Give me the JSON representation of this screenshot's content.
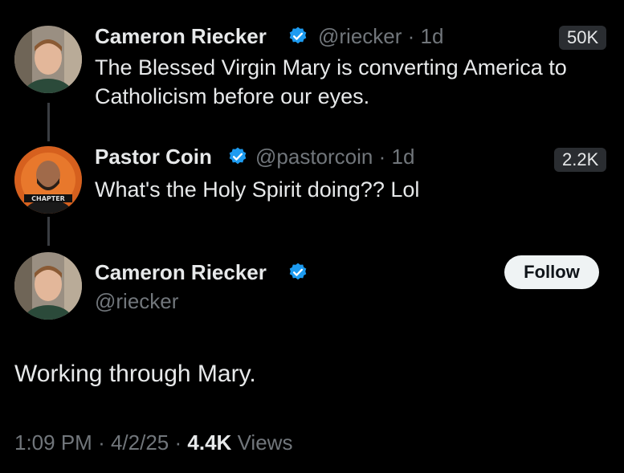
{
  "thread": [
    {
      "name": "Cameron Riecker",
      "handle": "@riecker",
      "dot": "·",
      "age": "1d",
      "text": "The Blessed Virgin Mary is converting America to Catholicism before our eyes.",
      "count": "50K"
    },
    {
      "name": "Pastor Coin",
      "handle": "@pastorcoin",
      "dot": "·",
      "age": "1d",
      "text": "What's the Holy Spirit doing?? Lol",
      "count": "2.2K"
    }
  ],
  "main": {
    "name": "Cameron Riecker",
    "handle": "@riecker",
    "follow_label": "Follow",
    "text": "Working through Mary.",
    "time": "1:09 PM",
    "sep": "·",
    "date": "4/2/25",
    "views_count": "4.4K",
    "views_label": "Views"
  },
  "colors": {
    "verified": "#1d9bf0",
    "secondary_text": "#71767b"
  },
  "icons": {
    "verified": "verified-badge-icon"
  }
}
